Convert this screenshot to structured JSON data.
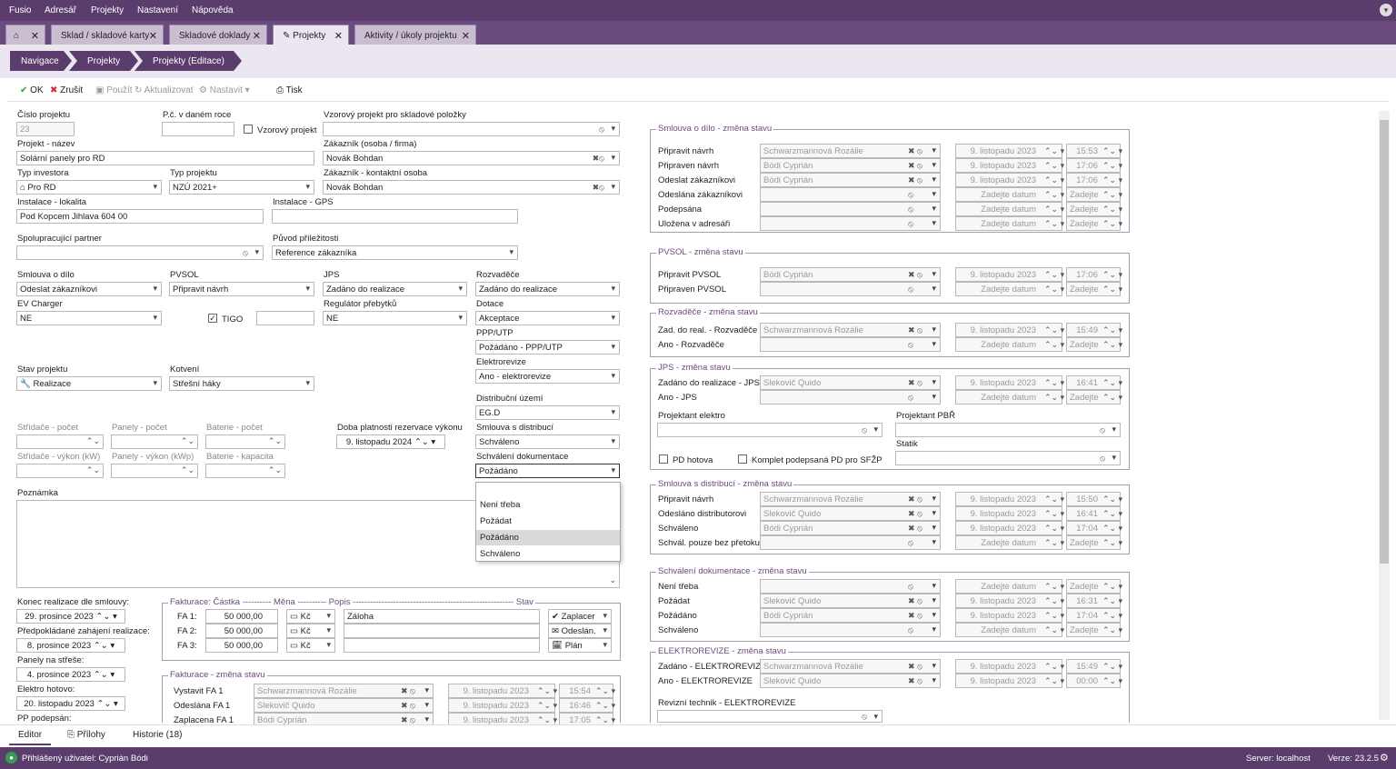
{
  "menu": {
    "items": [
      "Fusio",
      "Adresář",
      "Projekty",
      "Nastavení",
      "Nápověda"
    ]
  },
  "tabs": [
    {
      "label": "Sklad / skladové karty"
    },
    {
      "label": "Skladové doklady"
    },
    {
      "label": "Projekty"
    },
    {
      "label": "Aktivity / úkoly projektu"
    }
  ],
  "breadcrumb": [
    "Navigace",
    "Projekty",
    "Projekty (Editace)"
  ],
  "toolbar": {
    "ok": "OK",
    "cancel": "Zrušit",
    "use": "Použít",
    "refresh": "Aktualizovat",
    "settings": "Nastavit",
    "print": "Tisk"
  },
  "form": {
    "cislo_label": "Číslo projektu",
    "cislo_value": "23",
    "pc_label": "P.č. v daném roce",
    "pc_value": "",
    "vzorovy_label": "Vzorový projekt",
    "vzorovy_sklad_label": "Vzorový projekt pro skladové položky",
    "nazev_label": "Projekt - název",
    "nazev_value": "Solární panely pro RD",
    "zakaznik_label": "Zákazník (osoba / firma)",
    "zakaznik_value": "Novák Bohdan",
    "typ_investora_label": "Typ investora",
    "typ_investora_value": "Pro RD",
    "typ_projektu_label": "Typ projektu",
    "typ_projektu_value": "NZÚ 2021+",
    "kontakt_label": "Zákazník - kontaktní osoba",
    "kontakt_value": "Novák Bohdan",
    "lokalita_label": "Instalace - lokalita",
    "lokalita_value": "Pod Kopcem Jihlava 604 00",
    "gps_label": "Instalace - GPS",
    "gps_value": "",
    "partner_label": "Spolupracující partner",
    "partner_value": "",
    "puvod_label": "Původ příležitosti",
    "puvod_value": "Reference zákazníka",
    "smlouva_label": "Smlouva o dílo",
    "smlouva_value": "Odeslat zákazníkovi",
    "pvsol_label": "PVSOL",
    "pvsol_value": "Připravit návrh",
    "jps_label": "JPS",
    "jps_value": "Zadáno do realizace",
    "rozvadece_label": "Rozvaděče",
    "rozvadece_value": "Zadáno do realizace",
    "ev_label": "EV Charger",
    "ev_value": "NE",
    "tigo_label": "TIGO",
    "tigo_value": "",
    "regulator_label": "Regulátor přebytků",
    "regulator_value": "NE",
    "dotace_label": "Dotace",
    "dotace_value": "Akceptace",
    "ppp_label": "PPP/UTP",
    "ppp_value": "Požádáno - PPP/UTP",
    "elektrorevize_label": "Elektrorevize",
    "elektrorevize_value": "Ano - elektrorevize",
    "stav_label": "Stav projektu",
    "stav_value": "Realizace",
    "kotveni_label": "Kotvení",
    "kotveni_value": "Střešní háky",
    "distribucni_label": "Distribuční území",
    "distribucni_value": "EG.D",
    "stridace_pocet_label": "Střídače - počet",
    "panely_pocet_label": "Panely - počet",
    "baterie_pocet_label": "Baterie - počet",
    "doba_label": "Doba platnosti rezervace výkonu",
    "doba_value": "9. listopadu 2024",
    "smlouva_dist_label": "Smlouva s distribucí",
    "smlouva_dist_value": "Schváleno",
    "stridace_vykon_label": "Střídače - výkon (kW)",
    "panely_vykon_label": "Panely - výkon (kWp)",
    "baterie_kap_label": "Baterie - kapacita",
    "schvaleni_label": "Schválení dokumentace",
    "schvaleni_value": "Požádáno",
    "poznamka_label": "Poznámka",
    "konec_label": "Konec realizace dle smlouvy:",
    "konec_value": "29. prosince 2023",
    "zahajeni_label": "Předpokládané zahájení realizace:",
    "zahajeni_value": "8. prosince 2023",
    "panely_strecha_label": "Panely na střeše:",
    "panely_strecha_value": "4. prosince 2023",
    "elektro_hotovo_label": "Elektro hotovo:",
    "elektro_hotovo_value": "20. listopadu 2023",
    "pp_label": "PP podepsán:"
  },
  "dropdown_options": [
    "Není třeba",
    "Požádat",
    "Požádáno",
    "Schváleno"
  ],
  "fakturace": {
    "header": "Fakturace:  Částka ---------- Měna ---------- Popis -------------------------------------------------------- Stav",
    "rows": [
      {
        "label": "FA 1:",
        "amount": "50 000,00",
        "currency": "Kč",
        "desc": "Záloha",
        "state": "Zaplacer"
      },
      {
        "label": "FA 2:",
        "amount": "50 000,00",
        "currency": "Kč",
        "desc": "",
        "state": "Odeslán."
      },
      {
        "label": "FA 3:",
        "amount": "50 000,00",
        "currency": "Kč",
        "desc": "",
        "state": "Plán"
      }
    ]
  },
  "fakturace_zmena": {
    "title": "Fakturace - změna stavu",
    "rows": [
      {
        "label": "Vystavit FA 1",
        "person": "Schwarzmannová Rozálie",
        "date": "9. listopadu 2023",
        "time": "15:54"
      },
      {
        "label": "Odeslána FA 1",
        "person": "Slekovič Quido",
        "date": "9. listopadu 2023",
        "time": "16:46"
      },
      {
        "label": "Zaplacena FA 1",
        "person": "Bódi Cyprián",
        "date": "9. listopadu 2023",
        "time": "17:05"
      }
    ]
  },
  "right": {
    "smlouva": {
      "title": "Smlouva o dílo - změna stavu",
      "rows": [
        {
          "label": "Připravit návrh",
          "person": "Schwarzmannová Rozálie",
          "date": "9. listopadu 2023",
          "time": "15:53"
        },
        {
          "label": "Připraven návrh",
          "person": "Bódi Cyprián",
          "date": "9. listopadu 2023",
          "time": "17:06"
        },
        {
          "label": "Odeslat zákazníkovi",
          "person": "Bódi Cyprián",
          "date": "9. listopadu 2023",
          "time": "17:06"
        },
        {
          "label": "Odeslána zákazníkovi",
          "person": "",
          "date": "Zadejte datum",
          "time": "Zadejte"
        },
        {
          "label": "Podepsána",
          "person": "",
          "date": "Zadejte datum",
          "time": "Zadejte"
        },
        {
          "label": "Uložena v adresáři",
          "person": "",
          "date": "Zadejte datum",
          "time": "Zadejte"
        }
      ]
    },
    "pvsol": {
      "title": "PVSOL - změna stavu",
      "rows": [
        {
          "label": "Připravit PVSOL",
          "person": "Bódi Cyprián",
          "date": "9. listopadu 2023",
          "time": "17:06"
        },
        {
          "label": "Připraven PVSOL",
          "person": "",
          "date": "Zadejte datum",
          "time": "Zadejte"
        }
      ]
    },
    "rozvadece": {
      "title": "Rozvaděče - změna stavu",
      "rows": [
        {
          "label": "Zad. do real. - Rozvaděče",
          "person": "Schwarzmannová Rozálie",
          "date": "9. listopadu 2023",
          "time": "15:49"
        },
        {
          "label": "Ano - Rozvaděče",
          "person": "",
          "date": "Zadejte datum",
          "time": "Zadejte"
        }
      ]
    },
    "jps": {
      "title": "JPS - změna stavu",
      "rows": [
        {
          "label": "Zadáno do realizace - JPS",
          "person": "Slekovič Quido",
          "date": "9. listopadu 2023",
          "time": "16:41"
        },
        {
          "label": "Ano - JPS",
          "person": "",
          "date": "Zadejte datum",
          "time": "Zadejte"
        }
      ],
      "projektant_elektro_label": "Projektant elektro",
      "projektant_pbr_label": "Projektant PBŘ",
      "statik_label": "Statik",
      "pd_hotova_label": "PD hotova",
      "komplet_label": "Komplet podepsaná PD pro SFŽP"
    },
    "distribuce": {
      "title": "Smlouva s distribucí - změna stavu",
      "rows": [
        {
          "label": "Připravit návrh",
          "person": "Schwarzmannová Rozálie",
          "date": "9. listopadu 2023",
          "time": "15:50"
        },
        {
          "label": "Odesláno distributorovi",
          "person": "Slekovič Quido",
          "date": "9. listopadu 2023",
          "time": "16:41"
        },
        {
          "label": "Schváleno",
          "person": "Bódi Cyprián",
          "date": "9. listopadu 2023",
          "time": "17:04"
        },
        {
          "label": "Schvál. pouze bez přetoku",
          "person": "",
          "date": "Zadejte datum",
          "time": "Zadejte"
        }
      ]
    },
    "schvaleni": {
      "title": "Schválení dokumentace - změna stavu",
      "rows": [
        {
          "label": "Není třeba",
          "person": "",
          "date": "Zadejte datum",
          "time": "Zadejte"
        },
        {
          "label": "Požádat",
          "person": "Slekovič Quido",
          "date": "9. listopadu 2023",
          "time": "16:31"
        },
        {
          "label": "Požádáno",
          "person": "Bódi Cyprián",
          "date": "9. listopadu 2023",
          "time": "17:04"
        },
        {
          "label": "Schváleno",
          "person": "",
          "date": "Zadejte datum",
          "time": "Zadejte"
        }
      ]
    },
    "elektrorevize": {
      "title": "ELEKTROREVIZE - změna stavu",
      "rows": [
        {
          "label": "Zadáno - ELEKTROREVIZE",
          "person": "Schwarzmannová Rozálie",
          "date": "9. listopadu 2023",
          "time": "15:49"
        },
        {
          "label": "Ano - ELEKTROREVIZE",
          "person": "Slekovič Quido",
          "date": "9. listopadu 2023",
          "time": "00:00"
        }
      ],
      "technik_label": "Revizní technik - ELEKTROREVIZE"
    }
  },
  "bottom_tabs": [
    "Editor",
    "Přílohy",
    "Historie (18)"
  ],
  "status": {
    "user": "Přihlášený uživatel: Cyprián Bódi",
    "server": "Server: localhost",
    "version": "Verze: 23.2.5"
  }
}
